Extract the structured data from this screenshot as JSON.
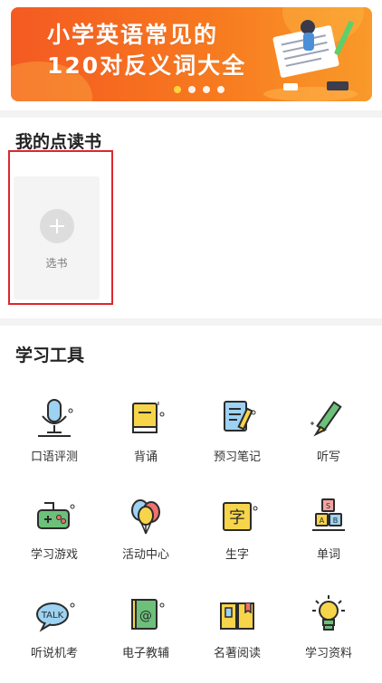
{
  "banner": {
    "title_line1": "小学英语常见的",
    "title_line2": "120对反义词大全",
    "pager_count": 4,
    "pager_active": 0
  },
  "my_books": {
    "title": "我的点读书",
    "add_label": "选书"
  },
  "tools_section": {
    "title": "学习工具",
    "items": [
      {
        "label": "口语评测",
        "icon": "microphone-icon"
      },
      {
        "label": "背诵",
        "icon": "book-icon"
      },
      {
        "label": "预习笔记",
        "icon": "notebook-pencil-icon"
      },
      {
        "label": "听写",
        "icon": "pencil-icon"
      },
      {
        "label": "学习游戏",
        "icon": "gamepad-icon"
      },
      {
        "label": "活动中心",
        "icon": "balloons-icon"
      },
      {
        "label": "生字",
        "icon": "character-card-icon"
      },
      {
        "label": "单词",
        "icon": "letter-blocks-icon"
      },
      {
        "label": "听说机考",
        "icon": "talk-bubble-icon"
      },
      {
        "label": "电子教辅",
        "icon": "ebook-icon"
      },
      {
        "label": "名著阅读",
        "icon": "open-book-icon"
      },
      {
        "label": "学习资料",
        "icon": "lightbulb-icon"
      }
    ]
  },
  "colors": {
    "banner_orange": "#f45a22",
    "highlight_red": "#e0262b",
    "icon_yellow": "#f7d54a",
    "icon_green": "#6cc07a"
  }
}
